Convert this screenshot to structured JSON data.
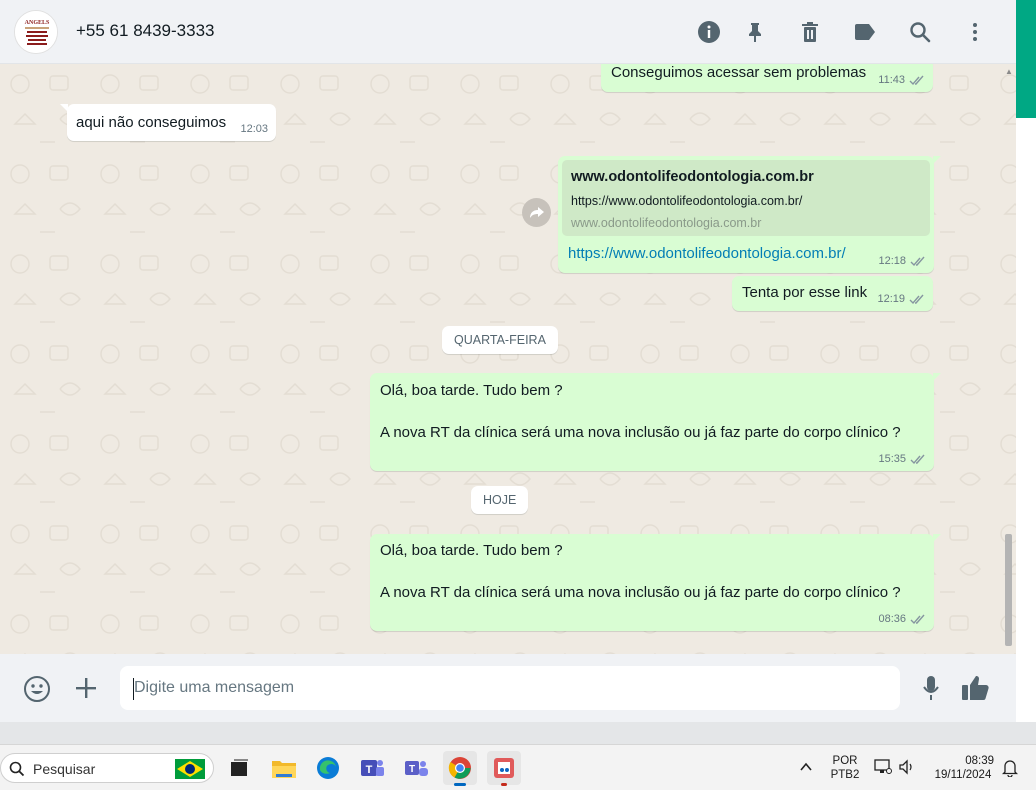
{
  "header": {
    "contact_name": "+55 61 8439-3333",
    "icons": [
      "info-icon",
      "pin-icon",
      "delete-icon",
      "label-icon",
      "search-icon",
      "more-options-icon"
    ]
  },
  "messages": [
    {
      "id": "m1",
      "direction": "outgoing",
      "text": "Conseguimos acessar sem problemas",
      "time": "11:43"
    },
    {
      "id": "m2",
      "direction": "incoming",
      "text": "aqui não conseguimos",
      "time": "12:03"
    },
    {
      "id": "m3",
      "direction": "outgoing",
      "type": "link_preview",
      "preview_title": "www.odontolifeodontologia.com.br",
      "preview_description": "https://www.odontolifeodontologia.com.br/",
      "preview_domain": "www.odontolifeodontologia.com.br",
      "link": "https://www.odontolifeodontologia.com.br/",
      "time": "12:18"
    },
    {
      "id": "m4",
      "direction": "outgoing",
      "text": "Tenta por esse link",
      "time": "12:19"
    },
    {
      "id": "d1",
      "type": "date_divider",
      "text": "QUARTA-FEIRA"
    },
    {
      "id": "m5",
      "direction": "outgoing",
      "line1": "Olá, boa tarde. Tudo bem ?",
      "line2": "A nova RT da clínica será uma nova inclusão ou já faz parte do corpo clínico ?",
      "time": "15:35"
    },
    {
      "id": "d2",
      "type": "date_divider",
      "text": "HOJE"
    },
    {
      "id": "m6",
      "direction": "outgoing",
      "line1": "Olá, boa tarde. Tudo bem ?",
      "line2": "A nova RT da clínica será uma nova inclusão ou já faz parte do corpo clínico ?",
      "time": "08:36"
    }
  ],
  "composer": {
    "placeholder": "Digite uma mensagem",
    "icons": [
      "emoji-icon",
      "attach-plus-icon",
      "microphone-icon",
      "thumbs-up-icon"
    ]
  },
  "taskbar": {
    "search_label": "Pesquisar",
    "language": "POR",
    "keyboard_layout": "PTB2",
    "time": "08:39",
    "date": "19/11/2024",
    "apps": [
      "task-view",
      "file-explorer",
      "edge",
      "teams-classic",
      "teams",
      "chrome",
      "snipping-tool"
    ]
  },
  "colors": {
    "outgoing_bubble": "#d9fdd3",
    "incoming_bubble": "#ffffff",
    "chat_background": "#efeae2",
    "accent": "#00a884",
    "link": "#027eb5",
    "read_tick": "#8696a0"
  }
}
